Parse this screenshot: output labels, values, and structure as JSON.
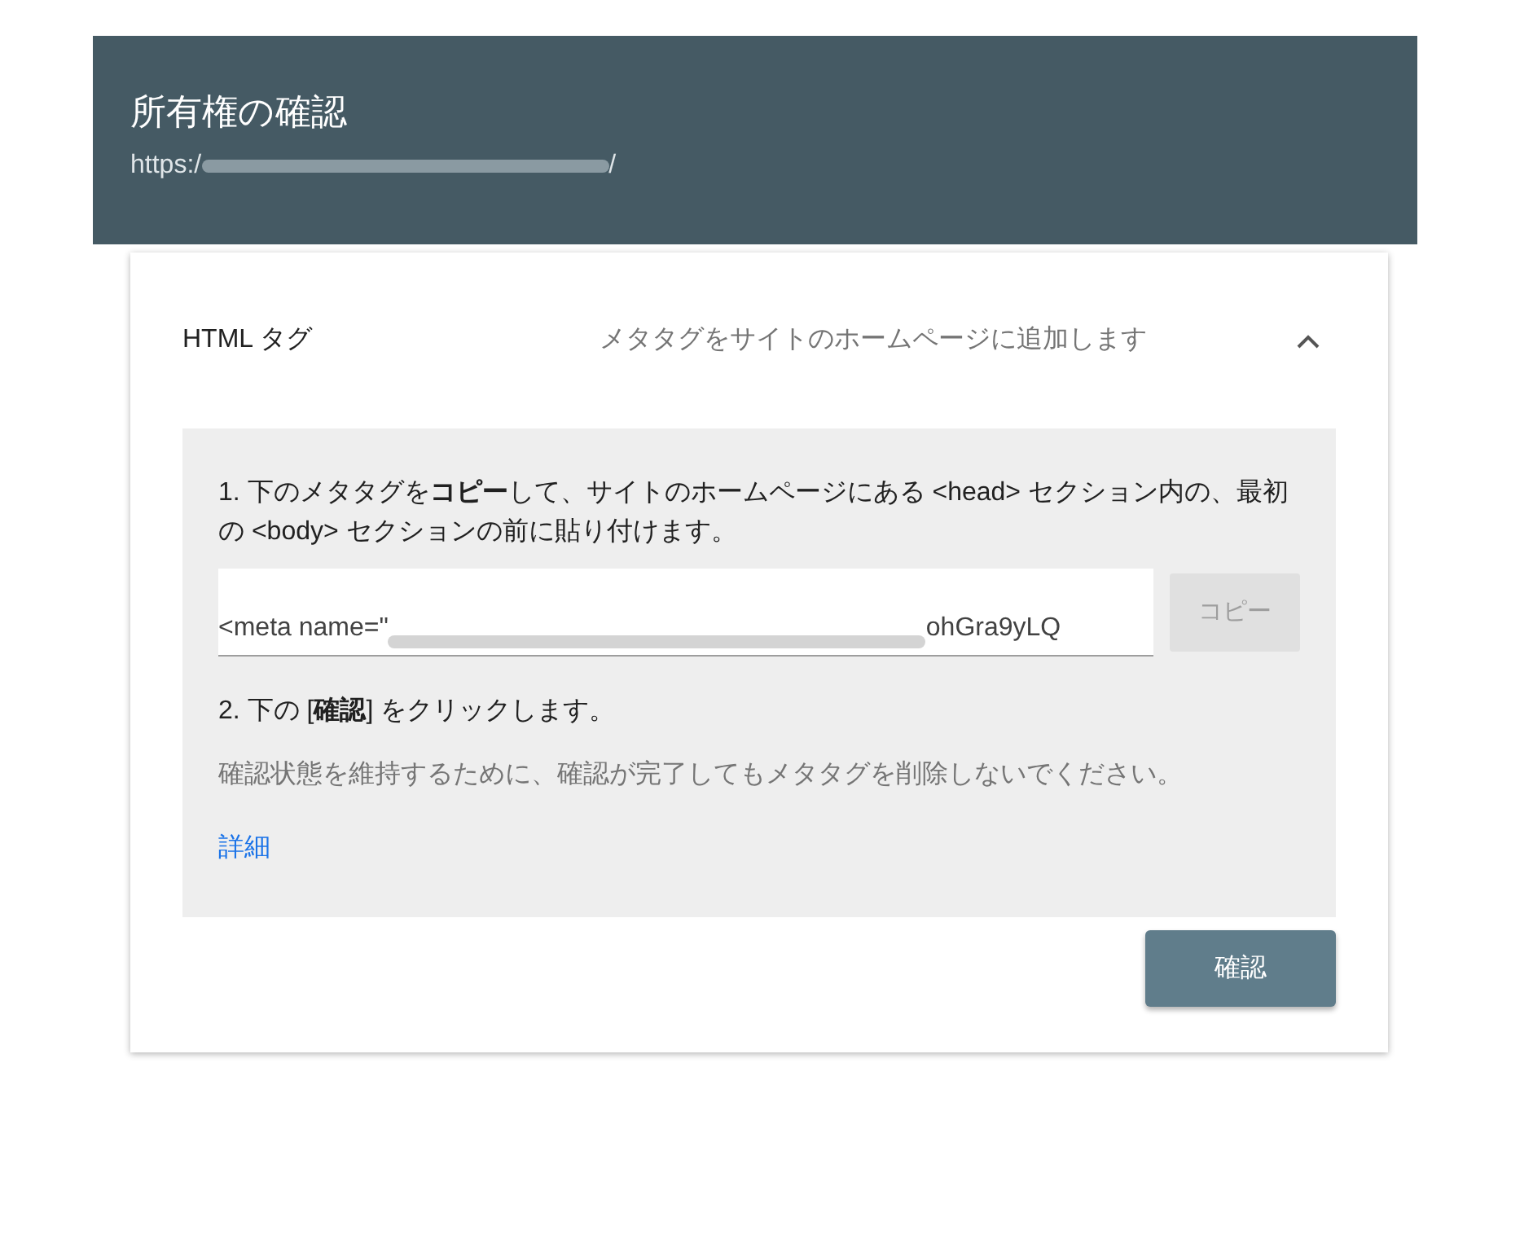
{
  "header": {
    "title": "所有権の確認",
    "url_prefix": "https:/",
    "url_suffix": "/"
  },
  "method": {
    "label": "HTML タグ",
    "description": "メタタグをサイトのホームページに追加します",
    "expanded": true
  },
  "steps": [
    {
      "text": "1. 下のメタタグを**コピー**して、サイトのホームページにある <head> セクション内の、最初の <body> セクションの前に貼り付けます。"
    },
    {
      "text": "2. 下の [**確認**] をクリックします。"
    }
  ],
  "meta_field": {
    "value_start": "<meta name=\"",
    "value_end": "ohGra9yLQ"
  },
  "copy_button": "コピー",
  "note": "確認状態を維持するために、確認が完了してもメタタグを削除しないでください。",
  "link": "詳細",
  "verify_button": "確認"
}
